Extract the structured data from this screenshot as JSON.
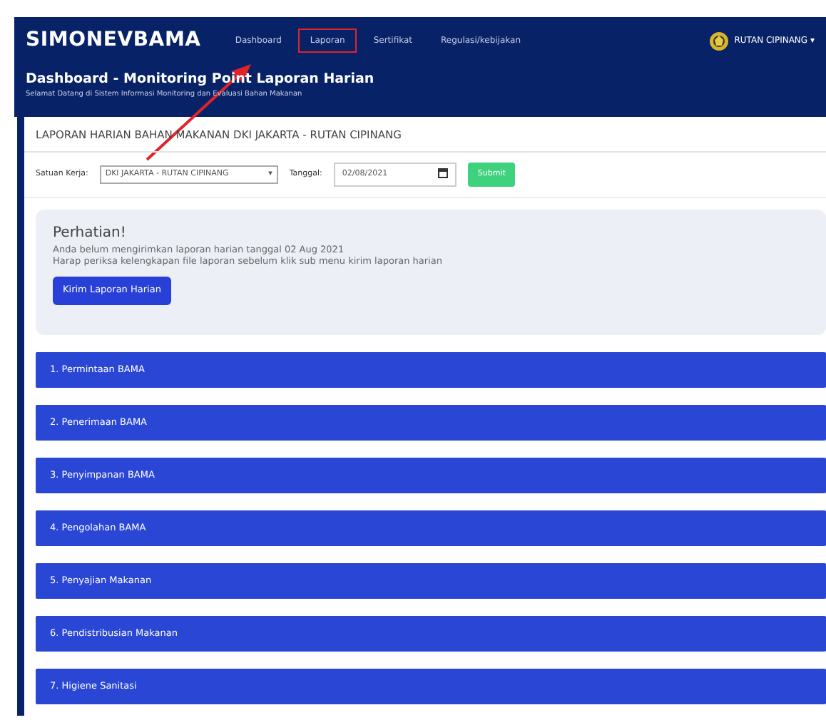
{
  "brand": "SIMONEVBAMA",
  "nav": [
    {
      "label": "Dashboard",
      "highlighted": false
    },
    {
      "label": "Laporan",
      "highlighted": true
    },
    {
      "label": "Sertifikat",
      "highlighted": false
    },
    {
      "label": "Regulasi/kebijakan",
      "highlighted": false
    }
  ],
  "user": {
    "name": "RUTAN CIPINANG",
    "caret": "▾"
  },
  "page_title": "Dashboard - Monitoring Point Laporan Harian",
  "page_subtitle": "Selamat Datang di Sistem Informasi Monitoring dan Evaluasi Bahan Makanan",
  "card_title": "LAPORAN HARIAN BAHAN MAKANAN DKI JAKARTA - RUTAN CIPINANG",
  "form": {
    "unit_label": "Satuan Kerja:",
    "unit_value": "DKI JAKARTA - RUTAN CIPINANG",
    "unit_caret": "▾",
    "date_label": "Tanggal:",
    "date_value": "02/08/2021",
    "submit": "Submit"
  },
  "alert": {
    "title": "Perhatian!",
    "lines": [
      "Anda belum mengirimkan laporan harian tanggal 02 Aug 2021",
      "Harap periksa kelengkapan file laporan sebelum klik sub menu kirim laporan harian"
    ],
    "button": "Kirim Laporan Harian"
  },
  "sections": [
    "1. Permintaan BAMA",
    "2. Penerimaan BAMA",
    "3. Penyimpanan BAMA",
    "4. Pengolahan BAMA",
    "5. Penyajian Makanan",
    "6. Pendistribusian Makanan",
    "7. Higiene Sanitasi"
  ]
}
